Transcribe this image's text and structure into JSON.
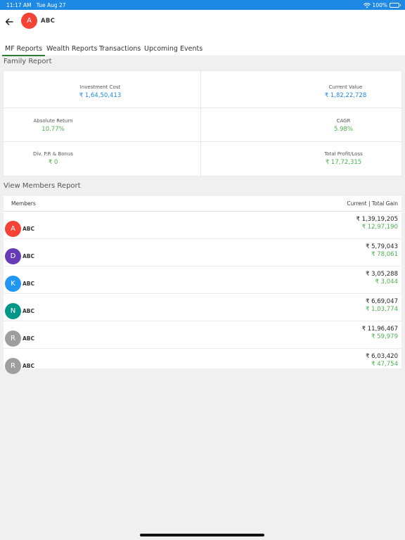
{
  "status_bar": {
    "time": "11:17 AM",
    "date": "Tue Aug 27",
    "battery": "100%"
  },
  "header": {
    "avatar_letter": "A",
    "avatar_color": "#f44336",
    "name": "ABC"
  },
  "tabs": [
    {
      "label": "MF Reports",
      "active": true
    },
    {
      "label": "Wealth Reports",
      "active": false
    },
    {
      "label": "Transactions",
      "active": false
    },
    {
      "label": "Upcoming Events",
      "active": false
    }
  ],
  "family_report": {
    "title": "Family Report",
    "investment_cost": {
      "label": "Investment Cost",
      "value": "₹ 1,64,50,413"
    },
    "current_value": {
      "label": "Current Value",
      "value": "₹ 1,82,22,728"
    },
    "absolute_return": {
      "label": "Absolute Return",
      "value": "10.77%"
    },
    "cagr": {
      "label": "CAGR",
      "value": "5.98%"
    },
    "dividend": {
      "label": "Div. P.R & Bonus",
      "value": "₹ 0"
    },
    "profit_loss": {
      "label": "Total Profit/Loss",
      "value": "₹ 17,72,315"
    }
  },
  "members_report": {
    "title": "View Members Report",
    "col_members": "Members",
    "col_values": "Current | Total Gain",
    "members": [
      {
        "letter": "A",
        "color": "#f44336",
        "name": "ABC",
        "current": "₹ 1,39,19,205",
        "gain": "₹ 12,97,190"
      },
      {
        "letter": "D",
        "color": "#673ab7",
        "name": "ABC",
        "current": "₹ 5,79,043",
        "gain": "₹ 78,061"
      },
      {
        "letter": "K",
        "color": "#2196f3",
        "name": "ABC",
        "current": "₹ 3,05,288",
        "gain": "₹ 3,044"
      },
      {
        "letter": "N",
        "color": "#009688",
        "name": "ABC",
        "current": "₹ 6,69,047",
        "gain": "₹ 1,03,774"
      },
      {
        "letter": "R",
        "color": "#9e9e9e",
        "name": "ABC",
        "current": "₹ 11,96,467",
        "gain": "₹ 59,979"
      },
      {
        "letter": "R",
        "color": "#9e9e9e",
        "name": "ABC",
        "current": "₹ 6,03,420",
        "gain": "₹ 47,754"
      }
    ]
  },
  "colors": {
    "status_bar": "#1e88e5",
    "accent_blue": "#1e88e5",
    "accent_green": "#4caf50",
    "tab_underline": "#2e7d32"
  }
}
